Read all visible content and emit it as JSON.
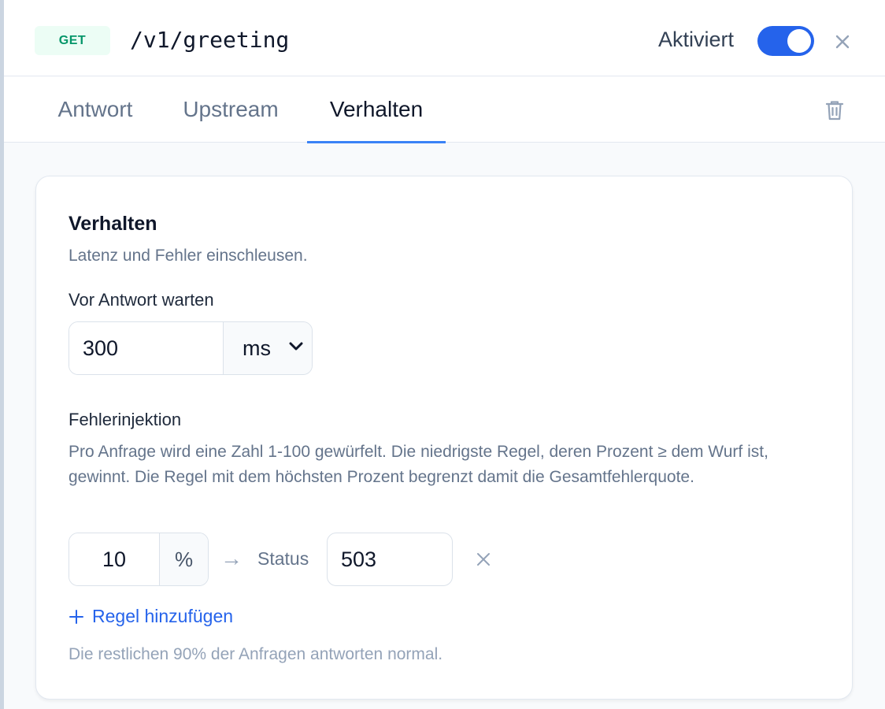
{
  "header": {
    "method": "GET",
    "path": "/v1/greeting",
    "status_label": "Aktiviert",
    "enabled": true
  },
  "tabs": [
    {
      "label": "Antwort",
      "active": false
    },
    {
      "label": "Upstream",
      "active": false
    },
    {
      "label": "Verhalten",
      "active": true
    }
  ],
  "behavior": {
    "title": "Verhalten",
    "subtitle": "Latenz und Fehler einschleusen.",
    "delay": {
      "label": "Vor Antwort warten",
      "value": "300",
      "unit": "ms"
    },
    "fault_injection": {
      "title": "Fehlerinjektion",
      "description": "Pro Anfrage wird eine Zahl 1-100 gewürfelt. Die niedrigste Regel, deren Prozent ≥ dem Wurf ist, gewinnt. Die Regel mit dem höchsten Prozent begrenzt damit die Gesamtfehlerquote.",
      "rules": [
        {
          "percent": "10",
          "percent_suffix": "%",
          "arrow": "→",
          "status_label": "Status",
          "status": "503"
        }
      ],
      "add_rule_label": "Regel hinzufügen",
      "footnote": "Die restlichen 90% der Anfragen antworten normal."
    }
  },
  "colors": {
    "accent": "#2563eb",
    "method_bg": "#ecfdf5",
    "method_fg": "#059669"
  }
}
